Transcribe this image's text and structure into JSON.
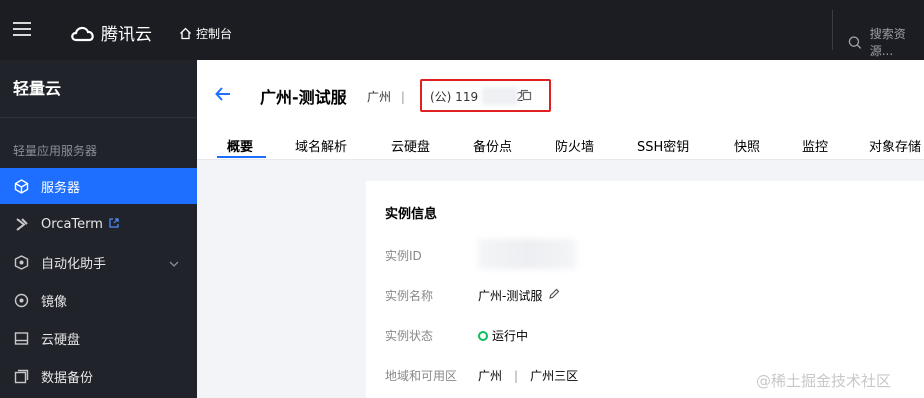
{
  "topbar": {
    "brand": "腾讯云",
    "console_label": "控制台",
    "search_placeholder": "搜索资源..."
  },
  "sidebar": {
    "title": "轻量云",
    "section": "轻量应用服务器",
    "items": [
      {
        "label": "服务器",
        "icon": "cube-icon",
        "active": true
      },
      {
        "label": "OrcaTerm",
        "icon": "terminal-icon",
        "external": true
      },
      {
        "label": "自动化助手",
        "icon": "robot-icon",
        "expandable": true
      },
      {
        "label": "镜像",
        "icon": "disc-icon"
      },
      {
        "label": "云硬盘",
        "icon": "disk-icon"
      },
      {
        "label": "数据备份",
        "icon": "backup-icon"
      }
    ]
  },
  "header": {
    "title": "广州-测试服",
    "region": "广州",
    "separator": "|",
    "ip_prefix": "(公) 119",
    "ip_suffix": "2"
  },
  "tabs": [
    "概要",
    "域名解析",
    "云硬盘",
    "备份点",
    "防火墙",
    "SSH密钥",
    "快照",
    "监控",
    "对象存储"
  ],
  "card": {
    "title": "实例信息",
    "rows": [
      {
        "label": "实例ID",
        "value": ""
      },
      {
        "label": "实例名称",
        "value": "广州-测试服"
      },
      {
        "label": "实例状态",
        "value": "运行中"
      },
      {
        "label": "地域和可用区",
        "value": "广州",
        "value2": "广州三区"
      }
    ]
  },
  "colors": {
    "accent": "#1e6fff",
    "status_running": "#0abf5b",
    "highlight_box": "#e02020"
  },
  "watermark": "@稀土掘金技术社区"
}
